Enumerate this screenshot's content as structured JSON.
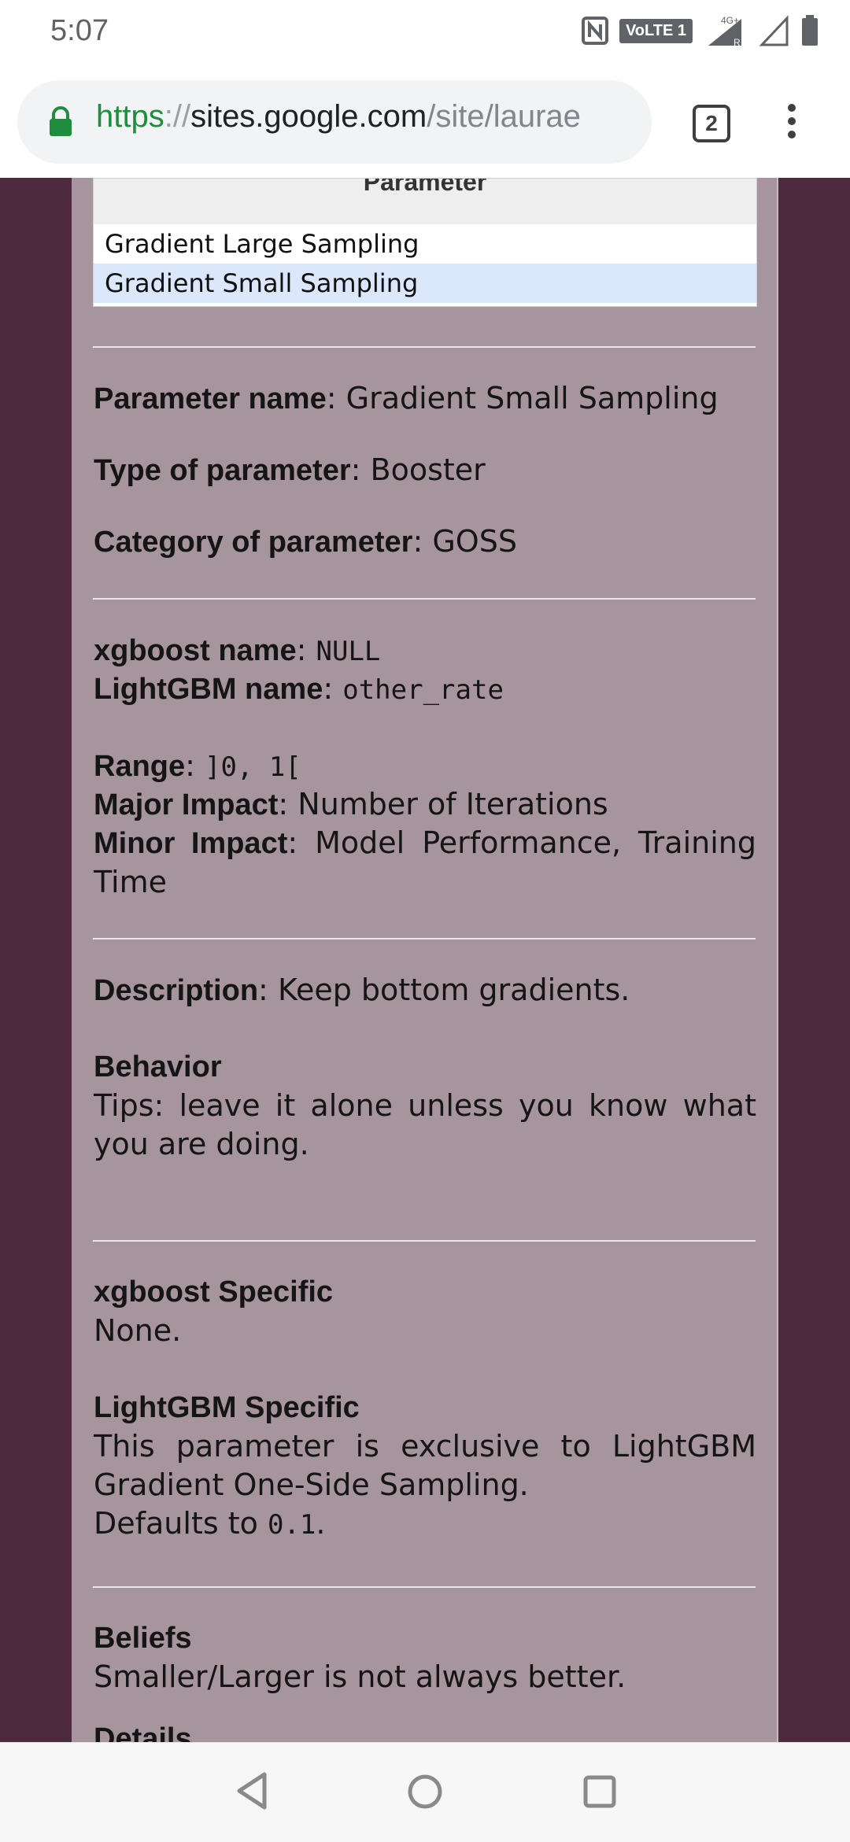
{
  "status_bar": {
    "time": "5:07",
    "network_badge": "VoLTE 1",
    "network_type": "4G+",
    "icons": [
      "nfc-icon",
      "signal-icon",
      "signal-icon",
      "battery-icon"
    ]
  },
  "browser": {
    "url_scheme": "https",
    "url_separator": "://",
    "url_host": "sites.google.com",
    "url_path": "/site/laurae",
    "tab_count": "2"
  },
  "table": {
    "header": "Parameter",
    "rows": [
      {
        "label": "Gradient Large Sampling",
        "selected": false
      },
      {
        "label": "Gradient Small Sampling",
        "selected": true
      }
    ]
  },
  "details": {
    "param_name_label": "Parameter name",
    "param_name_value": "Gradient Small Sampling",
    "type_label": "Type of parameter",
    "type_value": "Booster",
    "category_label": "Category of parameter",
    "category_value": "GOSS",
    "xgboost_name_label": "xgboost name",
    "xgboost_name_value": "NULL",
    "lightgbm_name_label": "LightGBM name",
    "lightgbm_name_value": "other_rate",
    "range_label": "Range",
    "range_value": "]0, 1[",
    "major_impact_label": "Major Impact",
    "major_impact_value": "Number of Iterations",
    "minor_impact_label": "Minor Impact",
    "minor_impact_value": "Model Performance, Training Time",
    "description_label": "Description",
    "description_value": "Keep bottom gradients.",
    "behavior_heading": "Behavior",
    "behavior_text": "Tips: leave it alone unless you know what you are doing.",
    "xgboost_specific_heading": "xgboost Specific",
    "xgboost_specific_text": "None.",
    "lightgbm_specific_heading": "LightGBM Specific",
    "lightgbm_specific_text": "This parameter is exclusive to LightGBM Gradient One-Side Sampling.",
    "defaults_prefix": "Defaults to",
    "defaults_value": "0.1",
    "defaults_suffix": ".",
    "beliefs_heading": "Beliefs",
    "beliefs_text": "Smaller/Larger is not always better.",
    "details_heading": "Details"
  },
  "colors": {
    "page_background": "#4e2a3e",
    "content_background": "#a6959c",
    "selected_row": "#dbe8fb",
    "url_scheme": "#1e8e3e"
  }
}
